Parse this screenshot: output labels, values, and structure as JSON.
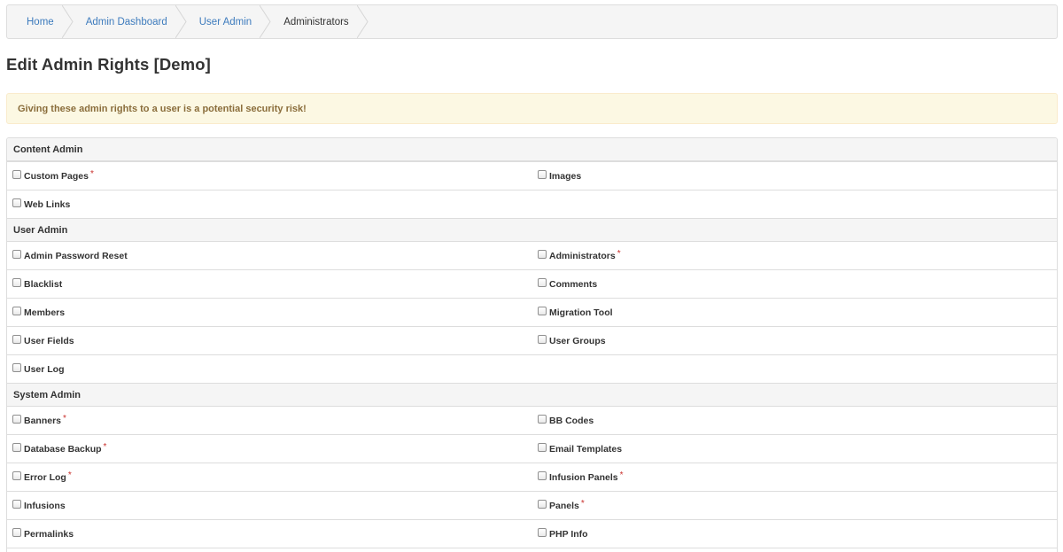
{
  "breadcrumb": [
    {
      "label": "Home",
      "current": false
    },
    {
      "label": "Admin Dashboard",
      "current": false
    },
    {
      "label": "User Admin",
      "current": false
    },
    {
      "label": "Administrators",
      "current": true
    }
  ],
  "page_title": "Edit Admin Rights [Demo]",
  "alert_text": "Giving these admin rights to a user is a potential security risk!",
  "required_marker": "*",
  "sections": [
    {
      "title": "Content Admin",
      "rows": [
        [
          {
            "label": "Custom Pages",
            "checked": false,
            "required": true
          },
          {
            "label": "Images",
            "checked": false,
            "required": false
          }
        ],
        [
          {
            "label": "Web Links",
            "checked": false,
            "required": false
          }
        ]
      ]
    },
    {
      "title": "User Admin",
      "rows": [
        [
          {
            "label": "Admin Password Reset",
            "checked": false,
            "required": false
          },
          {
            "label": "Administrators",
            "checked": false,
            "required": true
          }
        ],
        [
          {
            "label": "Blacklist",
            "checked": false,
            "required": false
          },
          {
            "label": "Comments",
            "checked": false,
            "required": false
          }
        ],
        [
          {
            "label": "Members",
            "checked": false,
            "required": false
          },
          {
            "label": "Migration Tool",
            "checked": false,
            "required": false
          }
        ],
        [
          {
            "label": "User Fields",
            "checked": false,
            "required": false
          },
          {
            "label": "User Groups",
            "checked": false,
            "required": false
          }
        ],
        [
          {
            "label": "User Log",
            "checked": false,
            "required": false
          }
        ]
      ]
    },
    {
      "title": "System Admin",
      "rows": [
        [
          {
            "label": "Banners",
            "checked": false,
            "required": true
          },
          {
            "label": "BB Codes",
            "checked": false,
            "required": false
          }
        ],
        [
          {
            "label": "Database Backup",
            "checked": false,
            "required": true
          },
          {
            "label": "Email Templates",
            "checked": false,
            "required": false
          }
        ],
        [
          {
            "label": "Error Log",
            "checked": false,
            "required": true
          },
          {
            "label": "Infusion Panels",
            "checked": false,
            "required": true
          }
        ],
        [
          {
            "label": "Infusions",
            "checked": false,
            "required": false
          },
          {
            "label": "Panels",
            "checked": false,
            "required": true
          }
        ],
        [
          {
            "label": "Permalinks",
            "checked": false,
            "required": false
          },
          {
            "label": "PHP Info",
            "checked": false,
            "required": false
          }
        ]
      ]
    }
  ],
  "colors": {
    "link": "#3d7bbd",
    "alert_bg": "#fcf8e3",
    "alert_text": "#8a6d3b",
    "required": "#c9302c"
  }
}
